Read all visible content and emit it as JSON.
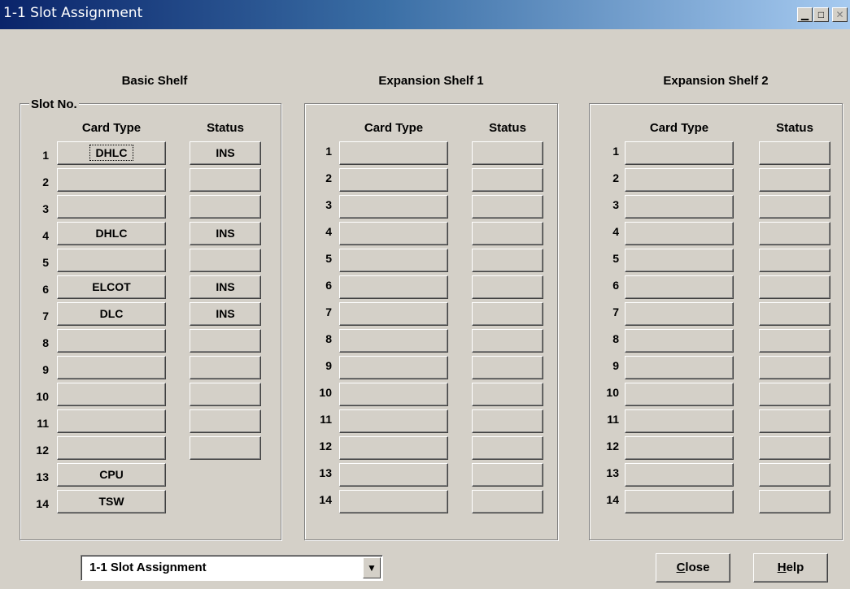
{
  "window": {
    "title": "1-1 Slot Assignment",
    "min_glyph": "▁",
    "max_glyph": "□",
    "close_glyph": "✕"
  },
  "labels": {
    "slot_no": "Slot No.",
    "card_type": "Card Type",
    "status": "Status"
  },
  "shelves": [
    {
      "title": "Basic Shelf",
      "slots": [
        {
          "num": "1",
          "card": "DHLC",
          "status": "INS"
        },
        {
          "num": "2",
          "card": "",
          "status": ""
        },
        {
          "num": "3",
          "card": "",
          "status": ""
        },
        {
          "num": "4",
          "card": "DHLC",
          "status": "INS"
        },
        {
          "num": "5",
          "card": "",
          "status": ""
        },
        {
          "num": "6",
          "card": "ELCOT",
          "status": "INS"
        },
        {
          "num": "7",
          "card": "DLC",
          "status": "INS"
        },
        {
          "num": "8",
          "card": "",
          "status": ""
        },
        {
          "num": "9",
          "card": "",
          "status": ""
        },
        {
          "num": "10",
          "card": "",
          "status": ""
        },
        {
          "num": "11",
          "card": "",
          "status": ""
        },
        {
          "num": "12",
          "card": "",
          "status": ""
        },
        {
          "num": "13",
          "card": "CPU"
        },
        {
          "num": "14",
          "card": "TSW"
        }
      ]
    },
    {
      "title": "Expansion Shelf 1",
      "slots": [
        {
          "num": "1",
          "card": "",
          "status": ""
        },
        {
          "num": "2",
          "card": "",
          "status": ""
        },
        {
          "num": "3",
          "card": "",
          "status": ""
        },
        {
          "num": "4",
          "card": "",
          "status": ""
        },
        {
          "num": "5",
          "card": "",
          "status": ""
        },
        {
          "num": "6",
          "card": "",
          "status": ""
        },
        {
          "num": "7",
          "card": "",
          "status": ""
        },
        {
          "num": "8",
          "card": "",
          "status": ""
        },
        {
          "num": "9",
          "card": "",
          "status": ""
        },
        {
          "num": "10",
          "card": "",
          "status": ""
        },
        {
          "num": "11",
          "card": "",
          "status": ""
        },
        {
          "num": "12",
          "card": "",
          "status": ""
        },
        {
          "num": "13",
          "card": "",
          "status": ""
        },
        {
          "num": "14",
          "card": "",
          "status": ""
        }
      ]
    },
    {
      "title": "Expansion Shelf 2",
      "slots": [
        {
          "num": "1",
          "card": "",
          "status": ""
        },
        {
          "num": "2",
          "card": "",
          "status": ""
        },
        {
          "num": "3",
          "card": "",
          "status": ""
        },
        {
          "num": "4",
          "card": "",
          "status": ""
        },
        {
          "num": "5",
          "card": "",
          "status": ""
        },
        {
          "num": "6",
          "card": "",
          "status": ""
        },
        {
          "num": "7",
          "card": "",
          "status": ""
        },
        {
          "num": "8",
          "card": "",
          "status": ""
        },
        {
          "num": "9",
          "card": "",
          "status": ""
        },
        {
          "num": "10",
          "card": "",
          "status": ""
        },
        {
          "num": "11",
          "card": "",
          "status": ""
        },
        {
          "num": "12",
          "card": "",
          "status": ""
        },
        {
          "num": "13",
          "card": "",
          "status": ""
        },
        {
          "num": "14",
          "card": "",
          "status": ""
        }
      ]
    }
  ],
  "footer": {
    "screen_select": "1-1 Slot Assignment",
    "close_prefix": "C",
    "close_rest": "lose",
    "help_prefix": "H",
    "help_rest": "elp",
    "dropdown_glyph": "▼"
  },
  "colors": {
    "face": "#d4d0c8",
    "title_start": "#0a246a",
    "title_end": "#a6caf0"
  }
}
